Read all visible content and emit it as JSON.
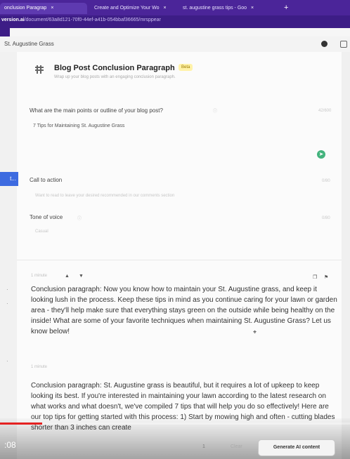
{
  "browser": {
    "tabs": [
      {
        "label": "onclusion Paragrap"
      },
      {
        "label": "Create and Optimize Your Wo"
      },
      {
        "label": "st. augustine grass tips - Goo"
      }
    ],
    "url_prefix": "version.ai",
    "url_rest": "/document/63a8d121-70f0-44ef-a41b-054bbaf36665/mrsppear"
  },
  "app": {
    "breadcrumb": "St. Augustine Grass"
  },
  "template": {
    "title": "Blog Post Conclusion Paragraph",
    "badge": "Beta",
    "description": "Wrap up your blog posts with an engaging conclusion paragraph."
  },
  "form": {
    "outline_label": "What are the main points or outline of your blog post?",
    "outline_value": "7 Tips for Maintaining St. Augustine Grass",
    "outline_count": "42/600",
    "cta_label": "Call to action",
    "cta_placeholder": "Want to read to leave your desired recommended in our comments section",
    "cta_count": "0/80",
    "tone_label": "Tone of voice",
    "tone_placeholder": "Casual",
    "tone_count": "0/80"
  },
  "left_rail": {
    "button_label": "t..."
  },
  "outputs": [
    {
      "meta": "1 minute",
      "text": "Conclusion paragraph: Now you know how to maintain your St. Augustine grass, and keep it looking lush in the process. Keep these tips in mind as you continue caring for your lawn or garden area - they'll help make sure that everything stays green on the outside while being healthy on the inside! What are some of your favorite techniques when maintaining St. Augustine Grass? Let us know below!"
    },
    {
      "meta": "1 minute",
      "text": "Conclusion paragraph: St. Augustine grass is beautiful, but it requires a lot of upkeep to keep looking its best. If you're interested in maintaining your lawn according to the latest research on what works and what doesn't, we've compiled 7 tips that will help you do so effectively! Here are our top tips for getting started with this process: 1) Start by mowing high and often - cutting blades shorter than 3 inches can create"
    }
  ],
  "footer": {
    "timer": ":08",
    "pager": "1",
    "clear_label": "Clear",
    "generate_label": "Generate AI content",
    "video_progress": 0.12
  },
  "colors": {
    "chrome": "#4b2599",
    "accent_blue": "#3d6be0",
    "send_green": "#43b37d",
    "progress_red": "#e52222"
  },
  "icons": [
    "eye-icon",
    "window-icon",
    "template-icon",
    "send-icon",
    "thumbs-up-icon",
    "thumbs-down-icon",
    "copy-icon",
    "pin-icon"
  ]
}
